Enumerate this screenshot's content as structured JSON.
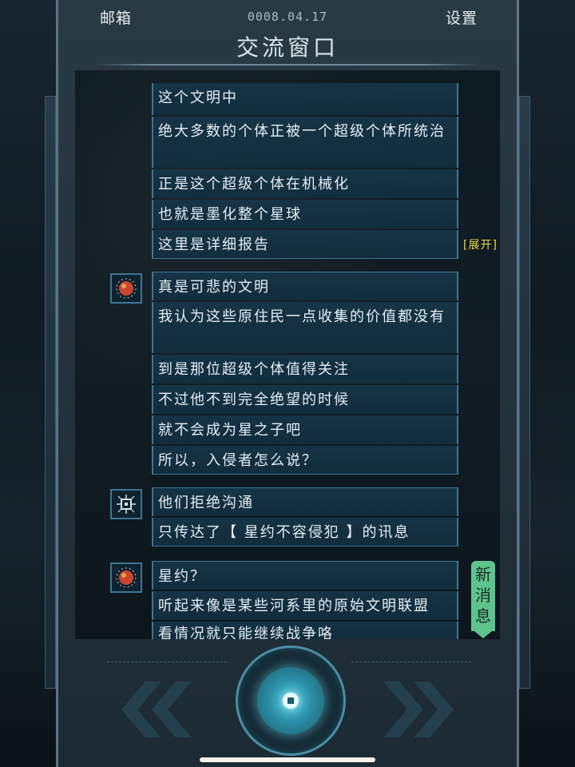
{
  "header": {
    "mail_label": "邮箱",
    "date": "0008.04.17",
    "settings_label": "设置",
    "title": "交流窗口"
  },
  "messages": [
    {
      "text": "这个文明中"
    },
    {
      "text": "绝大多数的个体正被一个超级个体所统治"
    },
    {
      "text": "正是这个超级个体在机械化"
    },
    {
      "text": "也就是墨化整个星球"
    },
    {
      "text": "这里是详细报告"
    },
    {
      "text": "真是可悲的文明"
    },
    {
      "text": "我认为这些原住民一点收集的价值都没有"
    },
    {
      "text": "到是那位超级个体值得关注"
    },
    {
      "text": "不过他不到完全绝望的时候"
    },
    {
      "text": "就不会成为星之子吧"
    },
    {
      "text": "所以，入侵者怎么说？"
    },
    {
      "text": "他们拒绝沟通"
    },
    {
      "text": "只传达了【 星约不容侵犯 】的讯息"
    },
    {
      "text": "星约？"
    },
    {
      "text": "听起来像是某些河系里的原始文明联盟"
    },
    {
      "text": "看情况就只能继续战争咯"
    }
  ],
  "expand_label": "[展开]",
  "new_message_badge": [
    "新",
    "消",
    "息"
  ],
  "avatars": [
    {
      "icon": "red-planet-avatar-icon"
    },
    {
      "icon": "circuit-chip-avatar-icon"
    },
    {
      "icon": "red-planet-avatar-icon"
    }
  ],
  "colors": {
    "accent": "#3f7592",
    "expand": "#e9d64a",
    "badge": "#5ec48d",
    "dial_glow": "#5fd2e6"
  },
  "controls": {
    "prev_icon": "double-chevron-left-icon",
    "center_icon": "dial-button-icon",
    "next_icon": "double-chevron-right-icon"
  }
}
